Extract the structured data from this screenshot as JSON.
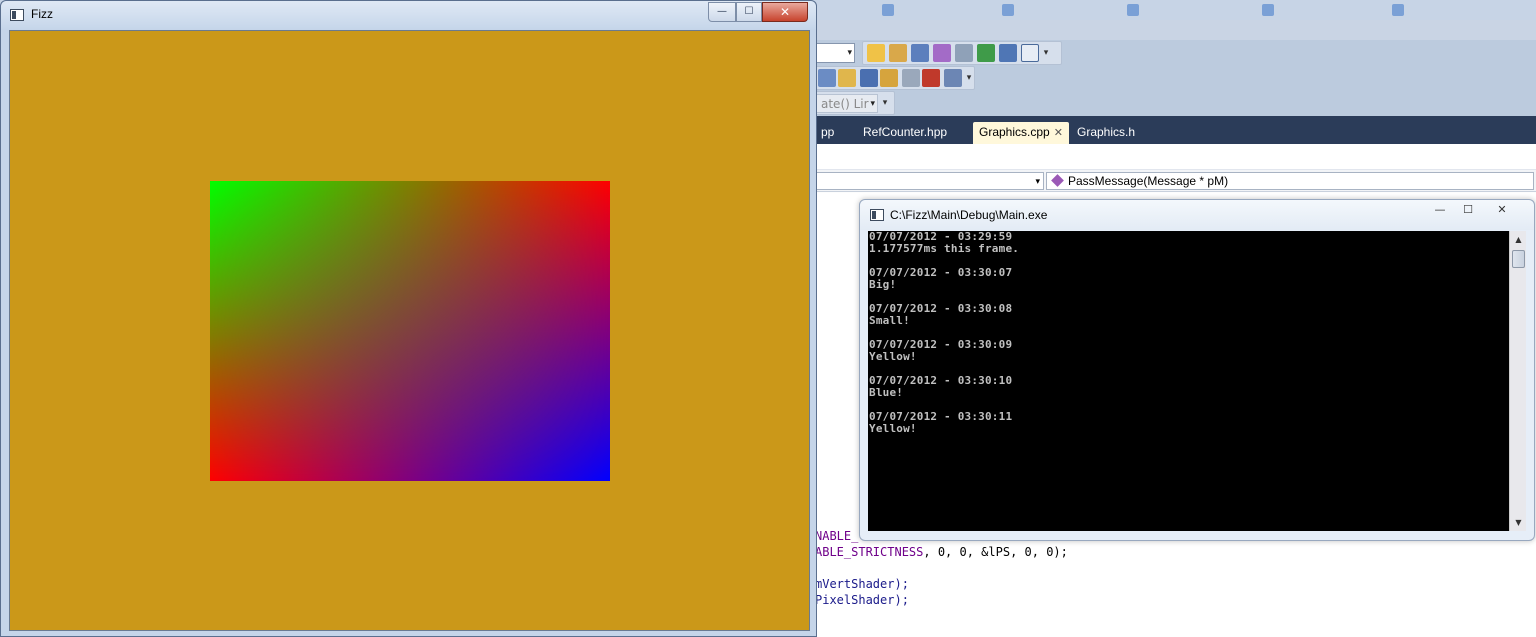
{
  "vs": {
    "toolbar_combo_text": "ate()  Lir",
    "tabs": [
      {
        "label": "pp"
      },
      {
        "label": "RefCounter.hpp"
      },
      {
        "label": "Graphics.cpp",
        "close": "✕"
      },
      {
        "label": "Graphics.h"
      }
    ],
    "nav_right": "PassMessage(Message * pM)",
    "code": [
      {
        "kw": "NABLE_",
        "tx": ""
      },
      {
        "kw": "ABLE_STRICTNESS",
        "tx": ", 0, 0, &lPS, 0, 0);"
      },
      {
        "kw": "",
        "tx": "mVertShader);"
      },
      {
        "kw": "",
        "tx": "PixelShader);"
      }
    ]
  },
  "fizz": {
    "title": "Fizz",
    "clear_color": "#cb9819",
    "gradient_corners": {
      "top_left": "#00ff00",
      "top_right": "#ff0000",
      "bottom_left": "#ff0000",
      "bottom_right": "#0000ff"
    }
  },
  "console": {
    "title": "C:\\Fizz\\Main\\Debug\\Main.exe",
    "lines": [
      "07/07/2012 - 03:29:59",
      "1.177577ms this frame.",
      "",
      "07/07/2012 - 03:30:07",
      "Big!",
      "",
      "07/07/2012 - 03:30:08",
      "Small!",
      "",
      "07/07/2012 - 03:30:09",
      "Yellow!",
      "",
      "07/07/2012 - 03:30:10",
      "Blue!",
      "",
      "07/07/2012 - 03:30:11",
      "Yellow!"
    ]
  },
  "icons": {
    "minimize": "—",
    "maximize": "☐",
    "close": "✕",
    "dropdown": "▾",
    "scroll_up": "▲",
    "scroll_down": "▼"
  }
}
